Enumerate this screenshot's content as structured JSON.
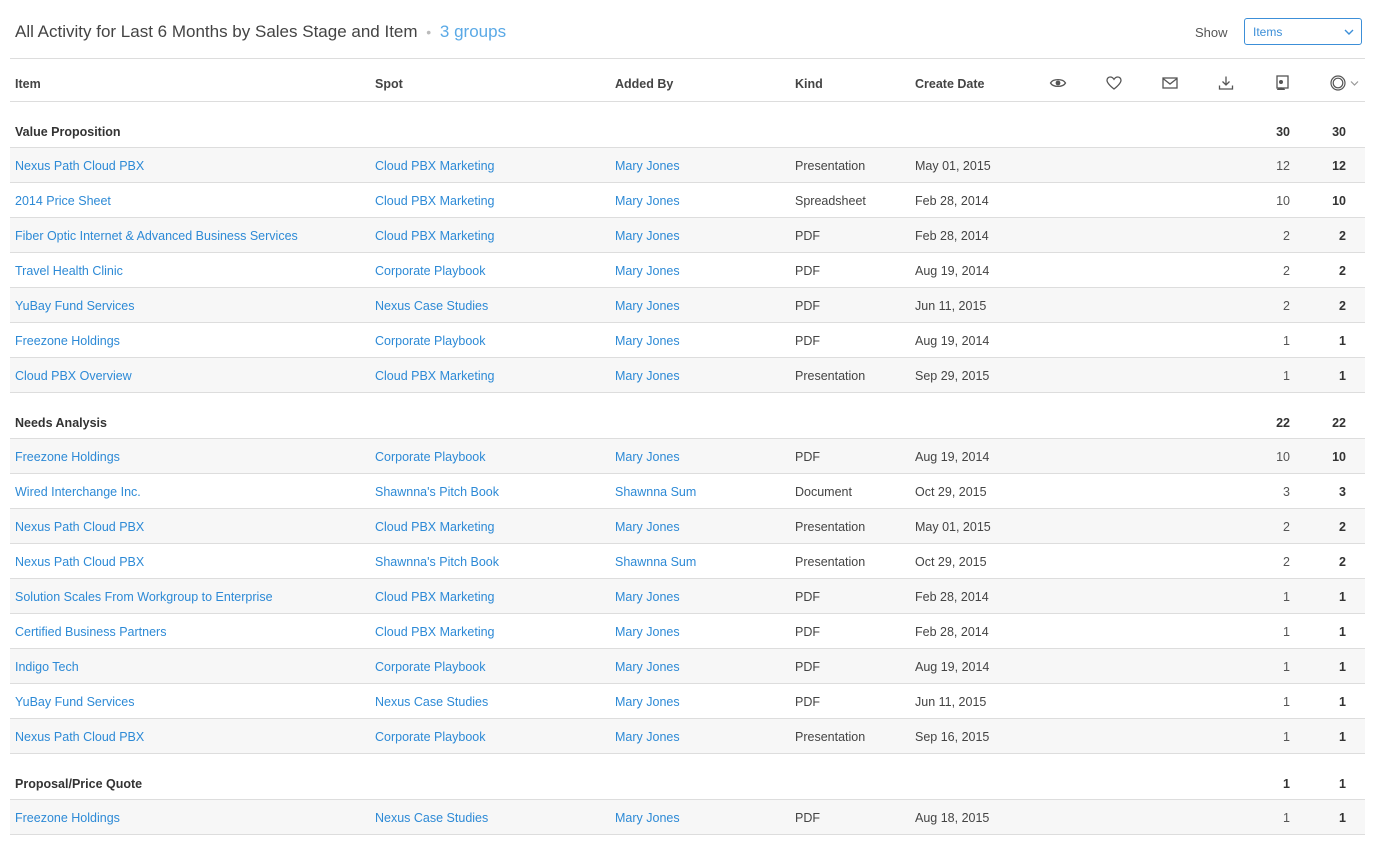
{
  "header": {
    "title": "All Activity for Last 6 Months by Sales Stage and Item",
    "separator": "•",
    "groups_label": "3 groups",
    "show_label": "Show",
    "show_value": "Items"
  },
  "columns": {
    "item": "Item",
    "spot": "Spot",
    "added_by": "Added By",
    "kind": "Kind",
    "create_date": "Create Date",
    "icons": [
      "eye-icon",
      "heart-icon",
      "mail-icon",
      "download-icon",
      "presenter-icon",
      "circle-icon"
    ]
  },
  "accent_color": "#2d8ad6",
  "groups": [
    {
      "name": "Value Proposition",
      "total1": "30",
      "total2": "30",
      "rows": [
        {
          "item": "Nexus Path Cloud PBX",
          "spot": "Cloud PBX Marketing",
          "added_by": "Mary Jones",
          "kind": "Presentation",
          "date": "May 01, 2015",
          "n1": "12",
          "n2": "12"
        },
        {
          "item": "2014 Price Sheet",
          "spot": "Cloud PBX Marketing",
          "added_by": "Mary Jones",
          "kind": "Spreadsheet",
          "date": "Feb 28, 2014",
          "n1": "10",
          "n2": "10"
        },
        {
          "item": "Fiber Optic Internet & Advanced Business Services",
          "spot": "Cloud PBX Marketing",
          "added_by": "Mary Jones",
          "kind": "PDF",
          "date": "Feb 28, 2014",
          "n1": "2",
          "n2": "2"
        },
        {
          "item": "Travel Health Clinic",
          "spot": "Corporate Playbook",
          "added_by": "Mary Jones",
          "kind": "PDF",
          "date": "Aug 19, 2014",
          "n1": "2",
          "n2": "2"
        },
        {
          "item": "YuBay Fund Services",
          "spot": "Nexus Case Studies",
          "added_by": "Mary Jones",
          "kind": "PDF",
          "date": "Jun 11, 2015",
          "n1": "2",
          "n2": "2"
        },
        {
          "item": "Freezone Holdings",
          "spot": "Corporate Playbook",
          "added_by": "Mary Jones",
          "kind": "PDF",
          "date": "Aug 19, 2014",
          "n1": "1",
          "n2": "1"
        },
        {
          "item": "Cloud PBX Overview",
          "spot": "Cloud PBX Marketing",
          "added_by": "Mary Jones",
          "kind": "Presentation",
          "date": "Sep 29, 2015",
          "n1": "1",
          "n2": "1"
        }
      ]
    },
    {
      "name": "Needs Analysis",
      "total1": "22",
      "total2": "22",
      "rows": [
        {
          "item": "Freezone Holdings",
          "spot": "Corporate Playbook",
          "added_by": "Mary Jones",
          "kind": "PDF",
          "date": "Aug 19, 2014",
          "n1": "10",
          "n2": "10"
        },
        {
          "item": "Wired Interchange Inc.",
          "spot": "Shawnna's Pitch Book",
          "added_by": "Shawnna Sum",
          "kind": "Document",
          "date": "Oct 29, 2015",
          "n1": "3",
          "n2": "3"
        },
        {
          "item": "Nexus Path Cloud PBX",
          "spot": "Cloud PBX Marketing",
          "added_by": "Mary Jones",
          "kind": "Presentation",
          "date": "May 01, 2015",
          "n1": "2",
          "n2": "2"
        },
        {
          "item": "Nexus Path Cloud PBX",
          "spot": "Shawnna's Pitch Book",
          "added_by": "Shawnna Sum",
          "kind": "Presentation",
          "date": "Oct 29, 2015",
          "n1": "2",
          "n2": "2"
        },
        {
          "item": "Solution Scales From Workgroup to Enterprise",
          "spot": "Cloud PBX Marketing",
          "added_by": "Mary Jones",
          "kind": "PDF",
          "date": "Feb 28, 2014",
          "n1": "1",
          "n2": "1"
        },
        {
          "item": "Certified Business Partners",
          "spot": "Cloud PBX Marketing",
          "added_by": "Mary Jones",
          "kind": "PDF",
          "date": "Feb 28, 2014",
          "n1": "1",
          "n2": "1"
        },
        {
          "item": "Indigo Tech",
          "spot": "Corporate Playbook",
          "added_by": "Mary Jones",
          "kind": "PDF",
          "date": "Aug 19, 2014",
          "n1": "1",
          "n2": "1"
        },
        {
          "item": "YuBay Fund Services",
          "spot": "Nexus Case Studies",
          "added_by": "Mary Jones",
          "kind": "PDF",
          "date": "Jun 11, 2015",
          "n1": "1",
          "n2": "1"
        },
        {
          "item": "Nexus Path Cloud PBX",
          "spot": "Corporate Playbook",
          "added_by": "Mary Jones",
          "kind": "Presentation",
          "date": "Sep 16, 2015",
          "n1": "1",
          "n2": "1"
        }
      ]
    },
    {
      "name": "Proposal/Price Quote",
      "total1": "1",
      "total2": "1",
      "rows": [
        {
          "item": "Freezone Holdings",
          "spot": "Nexus Case Studies",
          "added_by": "Mary Jones",
          "kind": "PDF",
          "date": "Aug 18, 2015",
          "n1": "1",
          "n2": "1"
        }
      ]
    }
  ]
}
